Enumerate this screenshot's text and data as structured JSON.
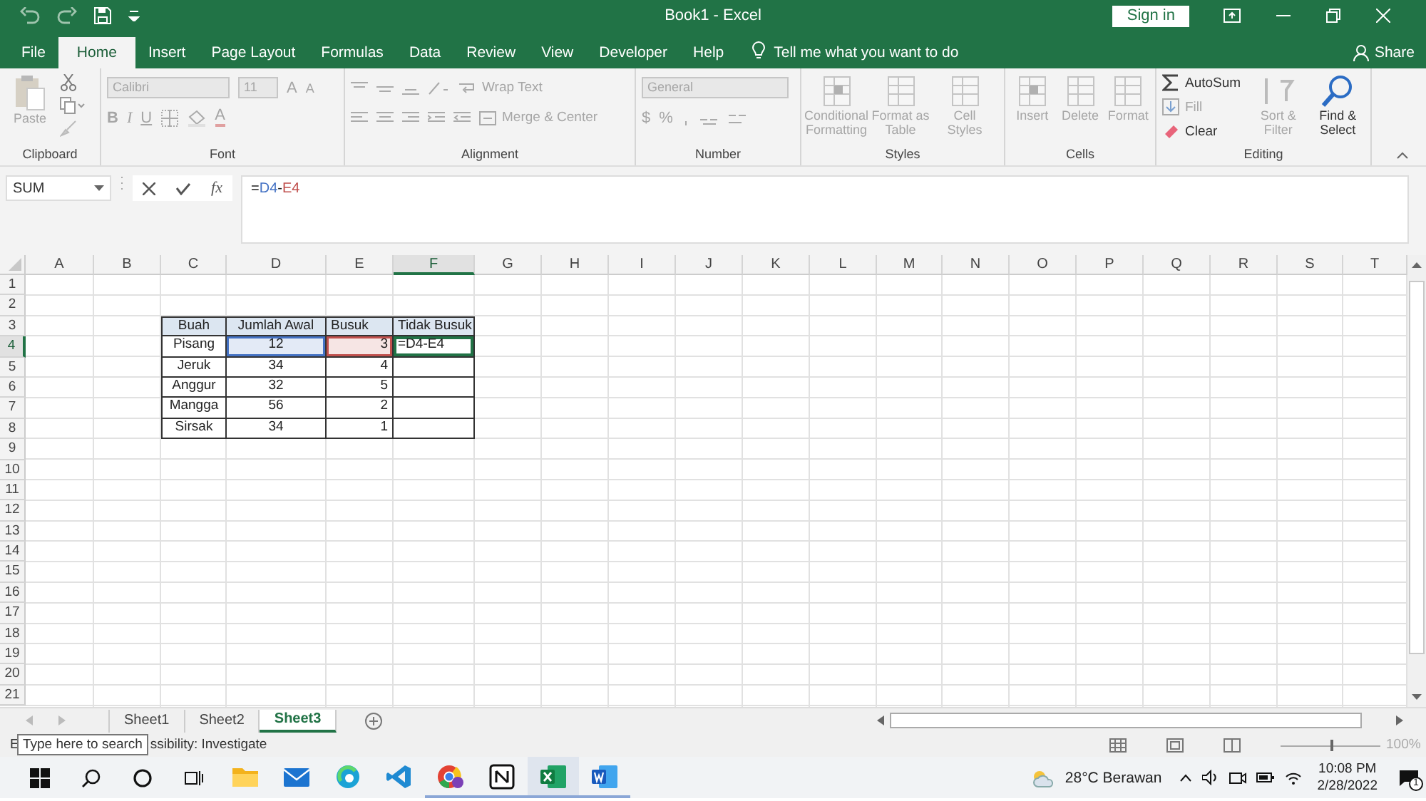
{
  "title_bar": {
    "title": "Book1 - Excel",
    "sign_in": "Sign in"
  },
  "menu_tabs": [
    {
      "label": "File",
      "selected": false
    },
    {
      "label": "Home",
      "selected": true
    },
    {
      "label": "Insert",
      "selected": false
    },
    {
      "label": "Page Layout",
      "selected": false
    },
    {
      "label": "Formulas",
      "selected": false
    },
    {
      "label": "Data",
      "selected": false
    },
    {
      "label": "Review",
      "selected": false
    },
    {
      "label": "View",
      "selected": false
    },
    {
      "label": "Developer",
      "selected": false
    },
    {
      "label": "Help",
      "selected": false
    }
  ],
  "tell_me": "Tell me what you want to do",
  "share": "Share",
  "ribbon": {
    "groups": [
      {
        "kind": "clipboard",
        "label": "Clipboard",
        "items": [
          {
            "label": "Paste",
            "disabled": true
          }
        ]
      },
      {
        "kind": "font",
        "label": "Font",
        "font_name": "Calibri",
        "font_size": "11",
        "grow": "A",
        "shrink": "A",
        "styles": [
          "B",
          "I",
          "U"
        ],
        "font_color": "A"
      },
      {
        "kind": "alignment",
        "label": "Alignment",
        "items": [
          {
            "label": "Wrap Text",
            "disabled": true
          },
          {
            "label": "Merge & Center",
            "disabled": true
          }
        ]
      },
      {
        "kind": "number",
        "label": "Number",
        "format": "General",
        "symbols": [
          "$",
          "%"
        ]
      },
      {
        "kind": "styles",
        "label": "Styles",
        "items": [
          {
            "label": "Conditional Formatting",
            "disabled": true
          },
          {
            "label": "Format as Table",
            "disabled": true
          },
          {
            "label": "Cell Styles",
            "disabled": true
          }
        ]
      },
      {
        "kind": "cells",
        "label": "Cells",
        "items": [
          {
            "label": "Insert",
            "disabled": true
          },
          {
            "label": "Delete",
            "disabled": true
          },
          {
            "label": "Format",
            "disabled": true
          }
        ]
      },
      {
        "kind": "editing",
        "label": "Editing",
        "items": [
          {
            "label": "AutoSum",
            "disabled": false
          },
          {
            "label": "Fill",
            "disabled": true
          },
          {
            "label": "Clear",
            "disabled": false
          },
          {
            "label": "Sort & Filter",
            "disabled": true
          },
          {
            "label": "Find & Select",
            "disabled": false
          }
        ]
      }
    ]
  },
  "formula_bar": {
    "name_box": "SUM",
    "function_label": "fx",
    "formula": [
      {
        "text": "="
      },
      {
        "text": "D4",
        "color": "#4472c4"
      },
      {
        "text": "-"
      },
      {
        "text": "E4",
        "color": "#c0504d"
      }
    ]
  },
  "sheet": {
    "columns": [
      {
        "label": "A",
        "selected": false
      },
      {
        "label": "B",
        "selected": false
      },
      {
        "label": "C",
        "selected": false
      },
      {
        "label": "D",
        "selected": false
      },
      {
        "label": "E",
        "selected": false
      },
      {
        "label": "F",
        "selected": true
      },
      {
        "label": "G",
        "selected": false
      },
      {
        "label": "H",
        "selected": false
      },
      {
        "label": "I",
        "selected": false
      },
      {
        "label": "J",
        "selected": false
      },
      {
        "label": "K",
        "selected": false
      },
      {
        "label": "L",
        "selected": false
      },
      {
        "label": "M",
        "selected": false
      },
      {
        "label": "N",
        "selected": false
      },
      {
        "label": "O",
        "selected": false
      },
      {
        "label": "P",
        "selected": false
      },
      {
        "label": "Q",
        "selected": false
      },
      {
        "label": "R",
        "selected": false
      },
      {
        "label": "S",
        "selected": false
      },
      {
        "label": "T",
        "selected": false
      }
    ],
    "rows": [
      {
        "label": "1",
        "selected": false
      },
      {
        "label": "2",
        "selected": false
      },
      {
        "label": "3",
        "selected": false
      },
      {
        "label": "4",
        "selected": true
      },
      {
        "label": "5",
        "selected": false
      },
      {
        "label": "6",
        "selected": false
      },
      {
        "label": "7",
        "selected": false
      },
      {
        "label": "8",
        "selected": false
      },
      {
        "label": "9",
        "selected": false
      },
      {
        "label": "10",
        "selected": false
      },
      {
        "label": "11",
        "selected": false
      },
      {
        "label": "12",
        "selected": false
      },
      {
        "label": "13",
        "selected": false
      },
      {
        "label": "14",
        "selected": false
      },
      {
        "label": "15",
        "selected": false
      },
      {
        "label": "16",
        "selected": false
      },
      {
        "label": "17",
        "selected": false
      },
      {
        "label": "18",
        "selected": false
      },
      {
        "label": "19",
        "selected": false
      },
      {
        "label": "20",
        "selected": false
      },
      {
        "label": "21",
        "selected": false
      }
    ],
    "table": {
      "header": [
        {
          "text": "Buah"
        },
        {
          "text": "Jumlah Awal"
        },
        {
          "text": "Busuk"
        },
        {
          "text": "Tidak Busuk"
        }
      ],
      "rows": [
        [
          {
            "text": "Pisang",
            "selected": false
          },
          {
            "text": "12",
            "selected": false,
            "color": "#4472c4"
          },
          {
            "text": "3",
            "selected": false,
            "color": "#c0504d"
          },
          {
            "text": "=D4-E4",
            "selected": true
          }
        ],
        [
          {
            "text": "Jeruk",
            "selected": false
          },
          {
            "text": "34",
            "selected": false
          },
          {
            "text": "4",
            "selected": false
          },
          {
            "selected": false
          }
        ],
        [
          {
            "text": "Anggur",
            "selected": false
          },
          {
            "text": "32",
            "selected": false
          },
          {
            "text": "5",
            "selected": false
          },
          {
            "selected": false
          }
        ],
        [
          {
            "text": "Mangga",
            "selected": false
          },
          {
            "text": "56",
            "selected": false
          },
          {
            "text": "2",
            "selected": false
          },
          {
            "selected": false
          }
        ],
        [
          {
            "text": "Sirsak",
            "selected": false
          },
          {
            "text": "34",
            "selected": false
          },
          {
            "text": "1",
            "selected": false
          },
          {
            "selected": false
          }
        ]
      ]
    }
  },
  "sheet_tabs": [
    {
      "label": "Sheet1",
      "selected": false
    },
    {
      "label": "Sheet2",
      "selected": false
    },
    {
      "label": "Sheet3",
      "selected": true
    }
  ],
  "status_bar": {
    "mode": "E",
    "accessibility": "ssibility: Investigate",
    "tooltip": "Type here to search",
    "zoom": "100%",
    "zoom_slider": {
      "level": 0.5
    }
  },
  "taskbar": {
    "apps": [
      {
        "running": false,
        "selected": false
      },
      {
        "running": false,
        "selected": false
      },
      {
        "running": false,
        "selected": false
      },
      {
        "running": false,
        "selected": false
      },
      {
        "running": true,
        "selected": false
      },
      {
        "running": true,
        "selected": false
      },
      {
        "running": true,
        "selected": true
      },
      {
        "running": true,
        "selected": false
      }
    ],
    "weather": "28°C Berawan",
    "time": "10:08 PM",
    "date": "2/28/2022",
    "notifications": "1"
  }
}
